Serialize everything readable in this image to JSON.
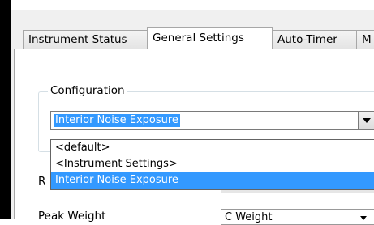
{
  "tabs": [
    {
      "label": "Instrument Status",
      "selected": false
    },
    {
      "label": "General Settings",
      "selected": true
    },
    {
      "label": "Auto-Timer",
      "selected": false
    },
    {
      "label": "M",
      "selected": false
    }
  ],
  "configuration": {
    "group_label": "Configuration",
    "selected_value": "Interior Noise Exposure",
    "options": [
      "<default>",
      "<Instrument Settings>",
      "Interior Noise Exposure"
    ],
    "highlighted_option": "Interior Noise Exposure"
  },
  "rows": {
    "r_label": "R",
    "peak_weight_label": "Peak Weight",
    "peak_weight_value": "C Weight"
  },
  "colors": {
    "selection": "#3399ff",
    "frame": "#000000"
  }
}
